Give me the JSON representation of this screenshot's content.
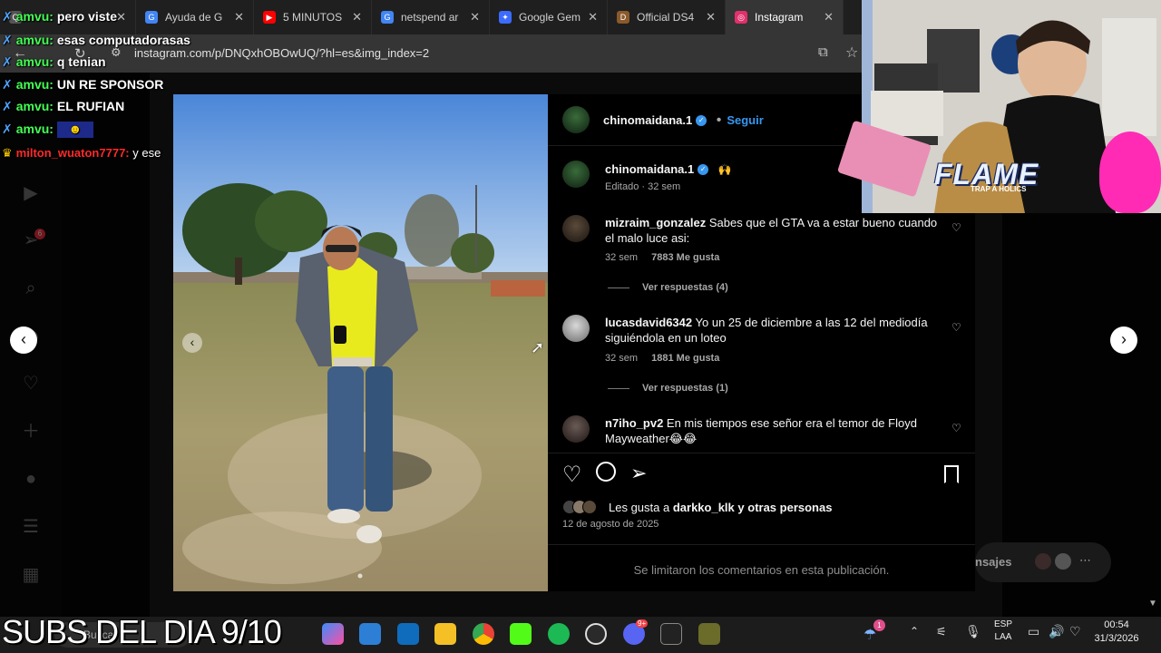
{
  "browser": {
    "tabs": [
      {
        "label": "",
        "color": "#555555",
        "glyph": "Q"
      },
      {
        "label": "Ayuda de G",
        "color": "#4285f4",
        "glyph": "G"
      },
      {
        "label": "5 MINUTOS",
        "color": "#ff0000",
        "glyph": "▶"
      },
      {
        "label": "netspend ar",
        "color": "#4285f4",
        "glyph": "G"
      },
      {
        "label": "Google Gem",
        "color": "#3b6cff",
        "glyph": "✦"
      },
      {
        "label": "Official DS4",
        "color": "#8b5a2b",
        "glyph": "D"
      },
      {
        "label": "Instagram",
        "color": "#e1306c",
        "glyph": "◎"
      }
    ],
    "url": "instagram.com/p/DNQxhOBOwUQ/?hl=es&img_index=2"
  },
  "chat": [
    {
      "user": "amvu:",
      "text": "pero viste"
    },
    {
      "user": "amvu:",
      "text": "esas computadorasas"
    },
    {
      "user": "amvu:",
      "text": "q tenian"
    },
    {
      "user": "amvu:",
      "text": "UN RE SPONSOR"
    },
    {
      "user": "amvu:",
      "text": "EL RUFIAN"
    },
    {
      "user": "amvu:",
      "text": ""
    },
    {
      "user": "milton_wuaton7777:",
      "text": "y ese"
    }
  ],
  "post": {
    "author": "chinomaidana.1",
    "follow": "Seguir",
    "caption_author": "chinomaidana.1",
    "caption_emoji": "🙌",
    "caption_meta": "Editado · 32 sem",
    "comments": [
      {
        "user": "mizraim_gonzalez",
        "text": "Sabes que el GTA va a estar bueno cuando el malo luce asi:",
        "time": "32 sem",
        "likes": "7883 Me gusta",
        "replies": "Ver respuestas (4)"
      },
      {
        "user": "lucasdavid6342",
        "text": "Yo un 25 de diciembre a las 12 del mediodía siguiéndola en un loteo",
        "time": "32 sem",
        "likes": "1881 Me gusta",
        "replies": "Ver respuestas (1)"
      },
      {
        "user": "n7iho_pv2",
        "text": "En mis tiempos ese señor era el temor de Floyd Mayweather😂😂"
      }
    ],
    "likes_prefix": "Les gusta a",
    "likes_user": "darkko_klk",
    "likes_suffix": "y otras personas",
    "date": "12 de agosto de 2025",
    "comments_limited": "Se limitaron los comentarios en esta publicación.",
    "messages_label": "nsajes"
  },
  "overlay": {
    "subs": "SUBS DEL DIA 9/10",
    "flame": "FLAME",
    "flame_sub": "TRAP A HOLICS"
  },
  "taskbar": {
    "search": "Buscar",
    "lang_top": "ESP",
    "lang_bottom": "LAA",
    "time": "00:54",
    "date": "31/3/2026",
    "notif_badge": "1",
    "discord_badge": "9+",
    "sidebar_badge": "6"
  },
  "colors": {
    "instagram_bg": "#000000",
    "verified": "#3897f0",
    "chat_user": "#44ff55"
  }
}
